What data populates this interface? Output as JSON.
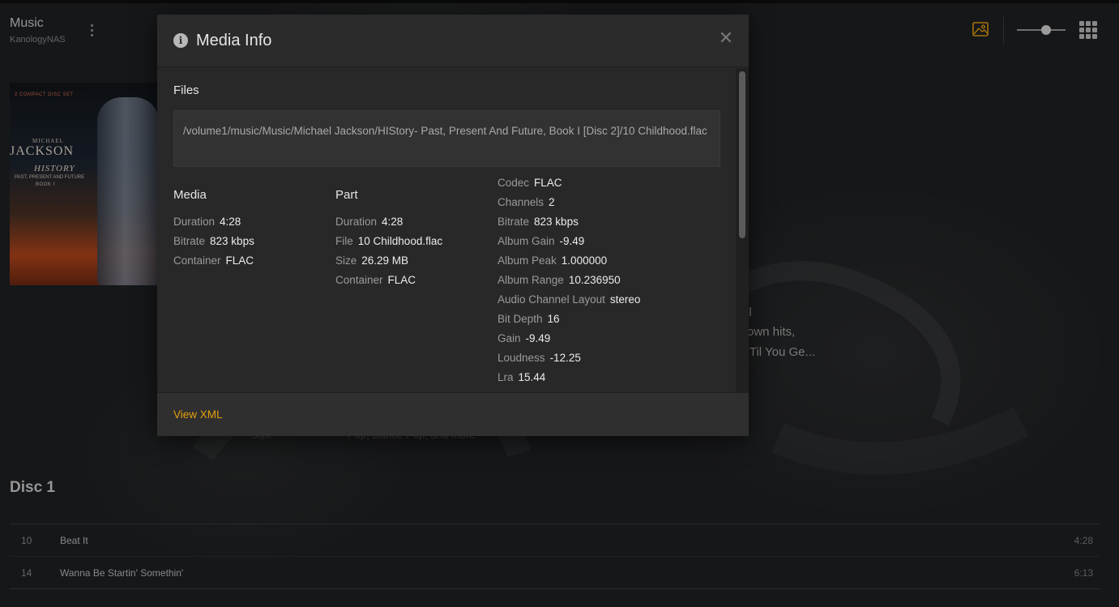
{
  "header": {
    "title": "Music",
    "server": "KanologyNAS"
  },
  "album_art": {
    "line1": "2 COMPACT DISC SET",
    "line2": "MICHAEL",
    "line3": "JACKSON",
    "line4": "HISTORY",
    "line5": "PAST, PRESENT AND FUTURE",
    "line6": "BOOK I"
  },
  "background": {
    "frag1": "al",
    "frag2": "own hits,",
    "frag3": "'Til You Ge...",
    "style_label": "Style",
    "style_value": "Pop, Dance-Pop, and more"
  },
  "disc": {
    "heading": "Disc 1",
    "tracks": [
      {
        "num": "10",
        "title": "Beat It",
        "duration": "4:28"
      },
      {
        "num": "14",
        "title": "Wanna Be Startin' Somethin'",
        "duration": "6:13"
      }
    ]
  },
  "modal": {
    "title": "Media Info",
    "files_label": "Files",
    "file_path": "/volume1/music/Music/Michael Jackson/HIStory- Past, Present And Future, Book I [Disc 2]/10 Childhood.flac",
    "media": {
      "heading": "Media",
      "props": [
        {
          "k": "Duration",
          "v": "4:28"
        },
        {
          "k": "Bitrate",
          "v": "823 kbps"
        },
        {
          "k": "Container",
          "v": "FLAC"
        }
      ]
    },
    "part": {
      "heading": "Part",
      "props": [
        {
          "k": "Duration",
          "v": "4:28"
        },
        {
          "k": "File",
          "v": "10 Childhood.flac"
        },
        {
          "k": "Size",
          "v": "26.29 MB"
        },
        {
          "k": "Container",
          "v": "FLAC"
        }
      ]
    },
    "stream": {
      "props": [
        {
          "k": "Codec",
          "v": "FLAC"
        },
        {
          "k": "Channels",
          "v": "2"
        },
        {
          "k": "Bitrate",
          "v": "823 kbps"
        },
        {
          "k": "Album Gain",
          "v": "-9.49"
        },
        {
          "k": "Album Peak",
          "v": "1.000000"
        },
        {
          "k": "Album Range",
          "v": "10.236950"
        },
        {
          "k": "Audio Channel Layout",
          "v": "stereo"
        },
        {
          "k": "Bit Depth",
          "v": "16"
        },
        {
          "k": "Gain",
          "v": "-9.49"
        },
        {
          "k": "Loudness",
          "v": "-12.25"
        },
        {
          "k": "Lra",
          "v": "15.44"
        }
      ]
    },
    "view_xml": "View XML"
  },
  "colors": {
    "accent": "#e5a00d",
    "background": "#1f2123",
    "modal": "#282828"
  },
  "icons": [
    "more-vertical-icon",
    "image-icon",
    "grid-icon",
    "info-icon",
    "close-icon"
  ]
}
